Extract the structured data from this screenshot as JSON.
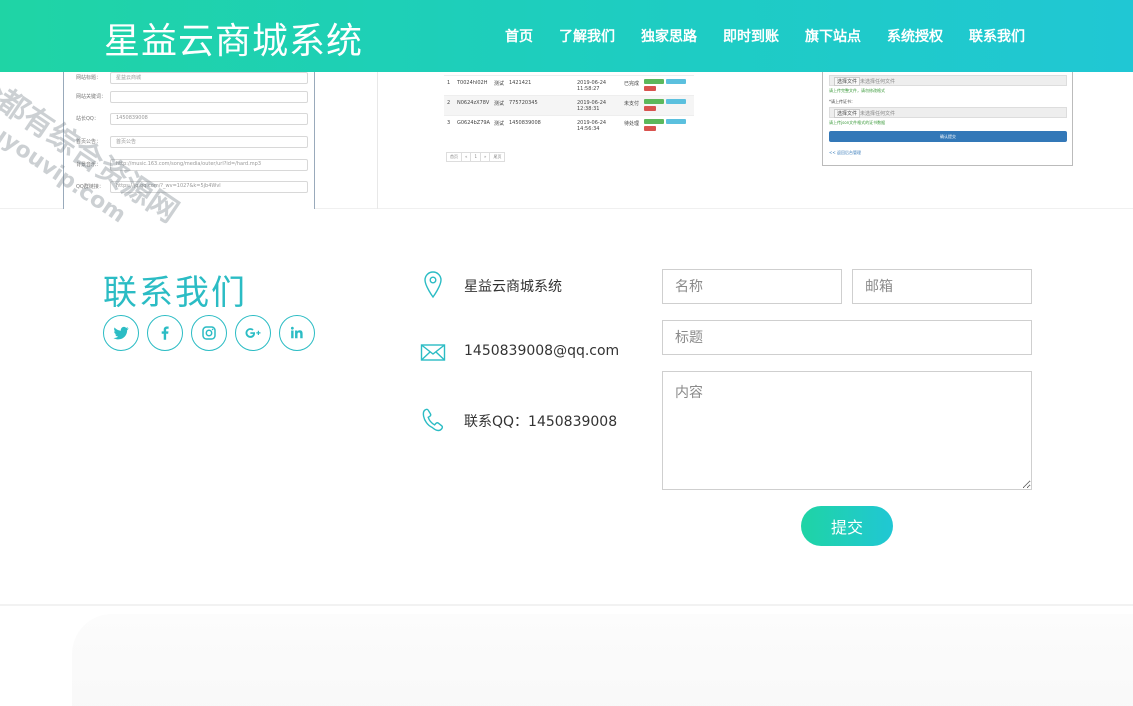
{
  "header": {
    "brand": "星益云商城系统",
    "nav": [
      "首页",
      "了解我们",
      "独家思路",
      "即时到账",
      "旗下站点",
      "系统授权",
      "联系我们"
    ]
  },
  "screenshot_left": {
    "rows": [
      {
        "label": "网站标题：",
        "value": "星益云商城"
      },
      {
        "label": "网站关键词：",
        "value": ""
      },
      {
        "label": "站长QQ：",
        "value": "1450839008"
      },
      {
        "label": "首页公告：",
        "value": "首页公告"
      },
      {
        "label": "背景音乐：",
        "value": "http://music.163.com/song/media/outer/url?id=/hard.mp3"
      },
      {
        "label": "QQ群链接：",
        "value": "https://jq.qq.com/?_wv=1027&k=5jb4Wvl"
      }
    ]
  },
  "screenshot_mid": {
    "rows": [
      {
        "id": "1",
        "order": "T0024hl02H",
        "name": "测试",
        "qq": "1421421",
        "time": "2019-06-24 11:58:27",
        "status": "已完成"
      },
      {
        "id": "2",
        "order": "N0624zX78V",
        "name": "测试",
        "qq": "775720345",
        "time": "2019-06-24 12:38:31",
        "status": "未支付"
      },
      {
        "id": "3",
        "order": "G0624bZ79A",
        "name": "测试",
        "qq": "1450839008",
        "time": "2019-06-24 14:56:34",
        "status": "待处理"
      }
    ],
    "pager": [
      "首页",
      "«",
      "1",
      "»",
      "尾页"
    ]
  },
  "screenshot_right": {
    "file_button": "选择文件",
    "file_text": "未选择任何文件",
    "note1": "请上传完整文件，请勿修改格式",
    "label2": "*请上传证书：",
    "note2": "请上传json文件格式的证书数据",
    "submit": "确认提交",
    "link": "<< 返回后台管理"
  },
  "contact": {
    "title": "联系我们",
    "socials": [
      "twitter-icon",
      "facebook-icon",
      "instagram-icon",
      "google-plus-icon",
      "linkedin-icon"
    ],
    "address": "星益云商城系统",
    "email": "1450839008@qq.com",
    "qq": "联系QQ：1450839008"
  },
  "form": {
    "name_placeholder": "名称",
    "email_placeholder": "邮箱",
    "subject_placeholder": "标题",
    "content_placeholder": "内容",
    "submit_label": "提交"
  },
  "watermark": {
    "line1": "全都有综合资源网",
    "line2": "douyouvip.com"
  },
  "colors": {
    "accent": "#2bbcc4",
    "gradient_start": "#1fd4a5",
    "gradient_end": "#20c7d4"
  }
}
